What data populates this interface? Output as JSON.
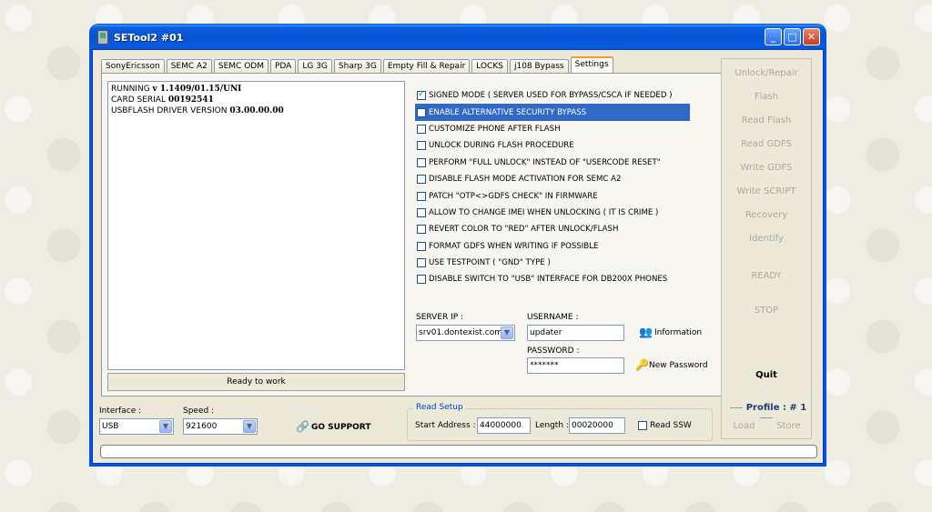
{
  "window": {
    "title": "SETool2 #01"
  },
  "titlebar": {
    "minimize": "_",
    "maximize": "□",
    "close": "✕"
  },
  "tabs": [
    "SonyEricsson",
    "SEMC A2",
    "SEMC ODM",
    "PDA",
    "LG 3G",
    "Sharp 3G",
    "Empty Fill & Repair",
    "LOCKS",
    "j108 Bypass",
    "Settings"
  ],
  "active_tab": "Settings",
  "log": {
    "line1_label": "RUNNING ",
    "line1_value": "v 1.1409/01.15/UNI",
    "line2_label": "CARD SERIAL ",
    "line2_value": "00192541",
    "line3_label": "USBFLASH DRIVER VERSION ",
    "line3_value": "03.00.00.00"
  },
  "status": "Ready to work",
  "options": [
    {
      "label": "SIGNED MODE ( SERVER USED FOR BYPASS/CSCA IF NEEDED )",
      "checked": true
    },
    {
      "label": "ENABLE ALTERNATIVE SECURITY BYPASS",
      "checked": false,
      "selected": true
    },
    {
      "label": "CUSTOMIZE PHONE AFTER FLASH",
      "checked": false
    },
    {
      "label": "UNLOCK DURING FLASH PROCEDURE",
      "checked": false
    },
    {
      "label": "PERFORM \"FULL UNLOCK\" INSTEAD OF \"USERCODE RESET\"",
      "checked": false
    },
    {
      "label": "DISABLE FLASH MODE ACTIVATION FOR SEMC A2",
      "checked": false
    },
    {
      "label": "PATCH \"OTP<>GDFS CHECK\" IN FIRMWARE",
      "checked": false
    },
    {
      "label": "ALLOW TO CHANGE IMEI WHEN UNLOCKING ( IT IS CRIME )",
      "checked": false
    },
    {
      "label": "REVERT COLOR TO \"RED\" AFTER UNLOCK/FLASH",
      "checked": false
    },
    {
      "label": "FORMAT GDFS WHEN WRITING IF POSSIBLE",
      "checked": false
    },
    {
      "label": "USE TESTPOINT ( \"GND\" TYPE )",
      "checked": false
    },
    {
      "label": "DISABLE SWITCH TO \"USB\" INTERFACE FOR DB200X PHONES",
      "checked": false
    }
  ],
  "server": {
    "ip_label": "SERVER IP :",
    "ip_value": "srv01.dontexist.com",
    "username_label": "USERNAME :",
    "username_value": "updater",
    "password_label": "PASSWORD :",
    "password_value": "*******",
    "information_label": "Information",
    "new_password_label": "New Password"
  },
  "sidebar": {
    "unlock_repair": "Unlock/Repair",
    "flash": "Flash",
    "read_flash": "Read Flash",
    "read_gdfs": "Read GDFS",
    "write_gdfs": "Write GDFS",
    "write_script": "Write SCRIPT",
    "recovery": "Recovery",
    "identify": "Identify",
    "ready": "READY",
    "stop": "STOP",
    "quit": "Quit",
    "profile": "Profile : # 1",
    "load": "Load",
    "store": "Store"
  },
  "bottom": {
    "interface_label": "Interface :",
    "interface_value": "USB",
    "speed_label": "Speed :",
    "speed_value": "921600",
    "go_support": "GO SUPPORT",
    "read_setup_title": "Read Setup",
    "start_address_label": "Start Address :",
    "start_address_value": "44000000",
    "length_label": "Length :",
    "length_value": "00020000",
    "read_ssw_label": "Read SSW"
  },
  "colors": {
    "titlebar": "#0553d4",
    "selection": "#316ac5",
    "disabled_text": "#aca899",
    "group_title": "#0046d5"
  }
}
